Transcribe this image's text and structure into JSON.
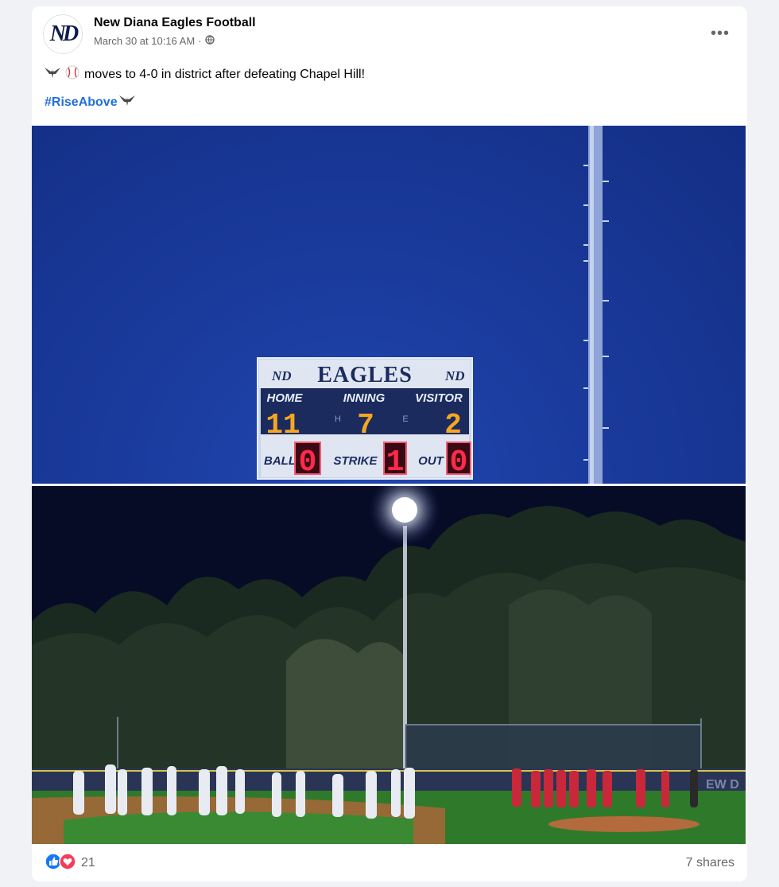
{
  "post": {
    "page_name": "New Diana Eagles Football",
    "avatar_text": "ND",
    "date": "March 30 at 10:16 AM",
    "separator": "·",
    "privacy_icon": "globe-icon",
    "more_label": "•••",
    "caption_icons": [
      "eagle-icon",
      "baseball-icon"
    ],
    "caption_text": "moves to 4-0 in district after defeating Chapel Hill!",
    "hashtag": "#RiseAbove",
    "hashtag_icon": "eagle-icon"
  },
  "scoreboard": {
    "team": "EAGLES",
    "logo_text": "ND",
    "headers": [
      "HOME",
      "INNING",
      "VISITOR"
    ],
    "home_score": "11",
    "inning": "7",
    "visitor_score": "2",
    "side_letters": [
      "H",
      "E"
    ],
    "count_labels": [
      "BALL",
      "STRIKE",
      "OUT"
    ],
    "ball": "0",
    "strike": "1",
    "out": "0"
  },
  "field": {
    "wall_text": "EW D"
  },
  "engagement": {
    "reaction_icons": [
      "like-icon",
      "love-icon"
    ],
    "reaction_count": "21",
    "shares": "7 shares"
  },
  "colors": {
    "hashtag": "#216fdb",
    "like": "#1877f2",
    "love": "#f33e58",
    "scoreboard_digits": "#f5a623",
    "count_digits": "#ff2a4a"
  }
}
